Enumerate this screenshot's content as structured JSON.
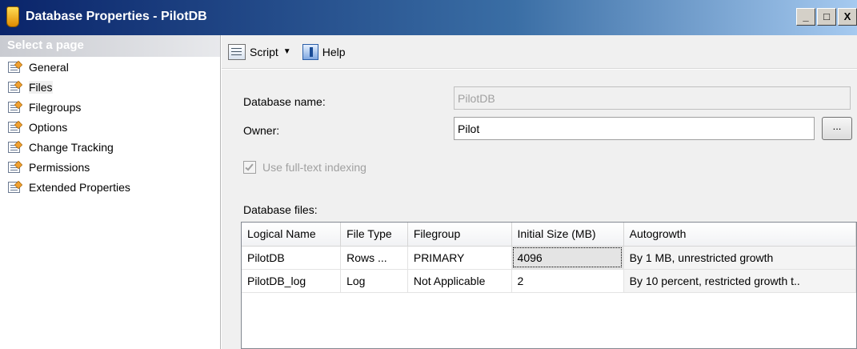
{
  "window": {
    "title": "Database Properties - PilotDB",
    "controls": {
      "minimize": "_",
      "maximize": "□",
      "close": "X"
    }
  },
  "sidebar": {
    "header": "Select a page",
    "items": [
      {
        "label": "General",
        "icon": "page-icon"
      },
      {
        "label": "Files",
        "icon": "page-icon",
        "selected": true
      },
      {
        "label": "Filegroups",
        "icon": "page-icon"
      },
      {
        "label": "Options",
        "icon": "page-icon"
      },
      {
        "label": "Change Tracking",
        "icon": "page-icon"
      },
      {
        "label": "Permissions",
        "icon": "page-icon"
      },
      {
        "label": "Extended Properties",
        "icon": "page-icon"
      }
    ]
  },
  "toolbar": {
    "script_label": "Script",
    "help_label": "Help"
  },
  "form": {
    "database_name_label": "Database name:",
    "database_name_value": "PilotDB",
    "owner_label": "Owner:",
    "owner_value": "Pilot",
    "browse_label": "...",
    "fulltext_label": "Use full-text indexing",
    "fulltext_checked": true
  },
  "files": {
    "label": "Database files:",
    "columns": [
      "Logical Name",
      "File Type",
      "Filegroup",
      "Initial Size (MB)",
      "Autogrowth"
    ],
    "rows": [
      [
        "PilotDB",
        "Rows ...",
        "PRIMARY",
        "4096",
        "By 1 MB, unrestricted growth"
      ],
      [
        "PilotDB_log",
        "Log",
        "Not Applicable",
        "2",
        "By 10 percent, restricted growth t.."
      ]
    ]
  }
}
